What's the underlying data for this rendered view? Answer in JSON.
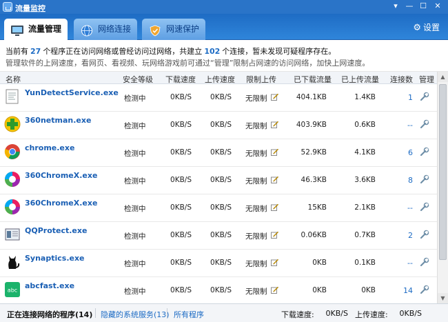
{
  "window": {
    "title": "流量监控",
    "menu_glyph": "▾",
    "min_glyph": "—",
    "max_glyph": "☐",
    "close_glyph": "✕"
  },
  "tabs": [
    {
      "label": "流量管理",
      "active": true
    },
    {
      "label": "网络连接",
      "active": false
    },
    {
      "label": "网速保护",
      "active": false
    }
  ],
  "settings_label": "设置",
  "summary": {
    "part1": "当前有",
    "program_count": "27",
    "part2": "个程序正在访问网络或曾经访问过网络，共建立",
    "connection_count": "102",
    "part3": "个连接，暂未发现可疑程序存在。",
    "hint": "管理软件的上网速度，看网页、看视频、玩网络游戏前可通过“管理”限制占网速的访问网络，加快上网速度。"
  },
  "columns": {
    "name": "名称",
    "security": "安全等级",
    "down_speed": "下载速度",
    "up_speed": "上传速度",
    "limit": "限制上传",
    "downloaded": "已下载流量",
    "uploaded": "已上传流量",
    "connections": "连接数",
    "manage": "管理"
  },
  "rows": [
    {
      "name": "YunDetectService.exe",
      "icon": "document-icon",
      "security": "检测中",
      "down": "0KB/S",
      "up": "0KB/S",
      "limit": "无限制",
      "downloaded": "404.1KB",
      "uploaded": "1.4KB",
      "conn": "1"
    },
    {
      "name": "360netman.exe",
      "icon": "360-plus-icon",
      "security": "检测中",
      "down": "0KB/S",
      "up": "0KB/S",
      "limit": "无限制",
      "downloaded": "403.9KB",
      "uploaded": "0.6KB",
      "conn": "--"
    },
    {
      "name": "chrome.exe",
      "icon": "chrome-icon",
      "security": "检测中",
      "down": "0KB/S",
      "up": "0KB/S",
      "limit": "无限制",
      "downloaded": "52.9KB",
      "uploaded": "4.1KB",
      "conn": "6"
    },
    {
      "name": "360ChromeX.exe",
      "icon": "360-chrome-icon",
      "security": "检测中",
      "down": "0KB/S",
      "up": "0KB/S",
      "limit": "无限制",
      "downloaded": "46.3KB",
      "uploaded": "3.6KB",
      "conn": "8"
    },
    {
      "name": "360ChromeX.exe",
      "icon": "360-chrome-icon",
      "security": "检测中",
      "down": "0KB/S",
      "up": "0KB/S",
      "limit": "无限制",
      "downloaded": "15KB",
      "uploaded": "2.1KB",
      "conn": "--"
    },
    {
      "name": "QQProtect.exe",
      "icon": "qqprotect-icon",
      "security": "检测中",
      "down": "0KB/S",
      "up": "0KB/S",
      "limit": "无限制",
      "downloaded": "0.06KB",
      "uploaded": "0.7KB",
      "conn": "2"
    },
    {
      "name": "Synaptics.exe",
      "icon": "black-cat-icon",
      "security": "检测中",
      "down": "0KB/S",
      "up": "0KB/S",
      "limit": "无限制",
      "downloaded": "0KB",
      "uploaded": "0.1KB",
      "conn": "--"
    },
    {
      "name": "abcfast.exe",
      "icon": "abc-icon",
      "security": "检测中",
      "down": "0KB/S",
      "up": "0KB/S",
      "limit": "无限制",
      "downloaded": "0KB",
      "uploaded": "0KB",
      "conn": "14"
    }
  ],
  "footer": {
    "tab_connected": "正在连接网络的程序(14)",
    "tab_hidden": "隐藏的系统服务(13)",
    "tab_all": "所有程序",
    "down_label": "下载速度:",
    "down_value": "0KB/S",
    "up_label": "上传速度:",
    "up_value": "0KB/S"
  },
  "colors": {
    "titlebar": "#2a74c8",
    "accent": "#1c6bc4",
    "link": "#1a5fb4"
  }
}
